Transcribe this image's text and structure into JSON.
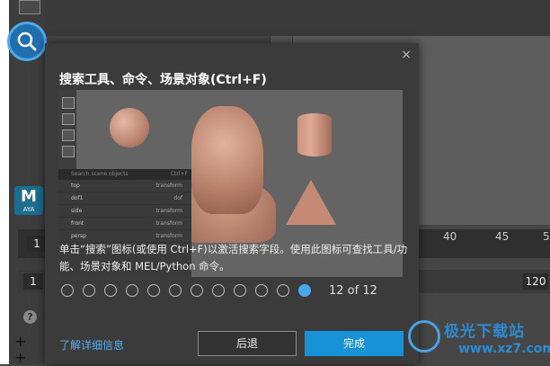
{
  "background": {
    "time_ticks": [
      "40",
      "45",
      "5"
    ],
    "start_frame": "1",
    "start_frame_2": "1",
    "end_frame": "120",
    "help_glyph": "?",
    "logo": {
      "letter": "M",
      "text": "AYA"
    },
    "watermark": {
      "line1": "极光下载站",
      "line2": "www.xz7.com"
    }
  },
  "dialog": {
    "title": "搜索工具、命令、场景对象(Ctrl+F)",
    "close_glyph": "×",
    "description": "单击“搜索”图标(或使用 Ctrl+F)以激活搜索字段。使用此图标可查找工具/功能、场景对象和 MEL/Python 命令。",
    "preview": {
      "search_placeholder": "Search scene objects",
      "search_shortcut": "Ctrl+F",
      "outliner_rows": [
        {
          "name": "top",
          "kind": "transform"
        },
        {
          "name": "dof1",
          "kind": "dof"
        },
        {
          "name": "side",
          "kind": "transform"
        },
        {
          "name": "front",
          "kind": "transform"
        },
        {
          "name": "persp",
          "kind": "transform"
        }
      ]
    },
    "pagination": {
      "total": 12,
      "current": 12,
      "label": "12 of 12"
    },
    "learn_more": "了解详细信息",
    "back_label": "后退",
    "done_label": "完成"
  },
  "colors": {
    "accent": "#1693d8",
    "link": "#55aef0"
  }
}
